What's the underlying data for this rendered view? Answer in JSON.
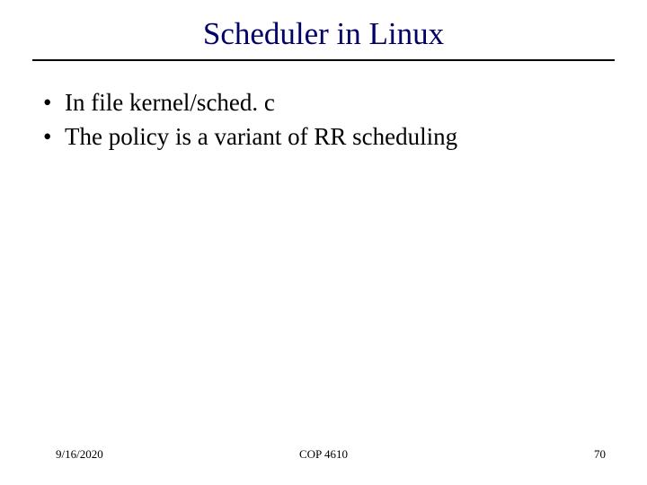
{
  "title": "Scheduler in Linux",
  "bullets": [
    "In file kernel/sched. c",
    "The policy is a variant of RR scheduling"
  ],
  "footer": {
    "date": "9/16/2020",
    "course": "COP 4610",
    "page": "70"
  }
}
